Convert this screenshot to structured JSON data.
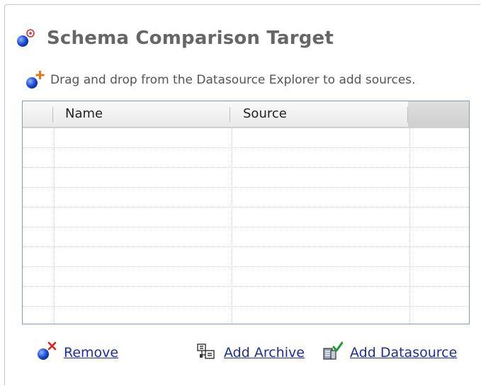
{
  "title": "Schema Comparison Target",
  "hint": "Drag and drop from the Datasource Explorer to add sources.",
  "table": {
    "columns": [
      "Name",
      "Source"
    ],
    "rows": []
  },
  "actions": {
    "remove": "Remove",
    "add_archive": "Add Archive",
    "add_datasource": "Add Datasource"
  },
  "icons": {
    "title": "database-target-icon",
    "hint": "database-add-icon",
    "remove": "database-remove-icon",
    "archive": "archive-icon",
    "datasource": "datasource-add-icon"
  },
  "colors": {
    "link": "#1f2d9a",
    "title": "#666666",
    "table_border": "#7f9db9"
  }
}
